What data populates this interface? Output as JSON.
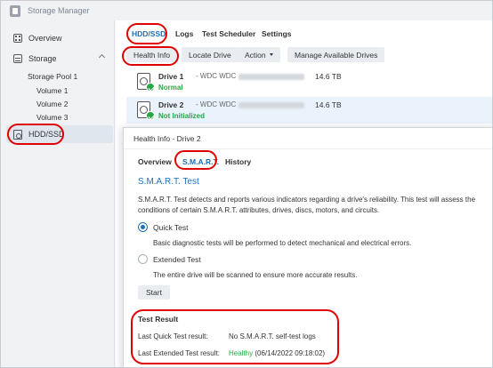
{
  "window": {
    "title": "Storage Manager"
  },
  "sidebar": {
    "overview": "Overview",
    "storage": "Storage",
    "storage_pool": "Storage Pool 1",
    "volumes": [
      "Volume 1",
      "Volume 2",
      "Volume 3"
    ],
    "hdd_ssd": "HDD/SSD"
  },
  "tabs": [
    "HDD/SSD",
    "Logs",
    "Test Scheduler",
    "Settings"
  ],
  "toolbar": {
    "health_info": "Health Info",
    "locate_drive": "Locate Drive",
    "action": "Action",
    "manage_drives": "Manage Available Drives"
  },
  "drives": [
    {
      "name": "Drive 1",
      "model": "- WDC WDC",
      "size": "14.6 TB",
      "status": "Normal"
    },
    {
      "name": "Drive 2",
      "model": "- WDC WDC",
      "size": "14.6 TB",
      "status": "Not Initialized"
    }
  ],
  "dialog": {
    "title": "Health Info - Drive 2",
    "tabs": [
      "Overview",
      "S.M.A.R.T.",
      "History"
    ],
    "section_title": "S.M.A.R.T. Test",
    "description_line1": "S.M.A.R.T. Test detects and reports various indicators regarding a drive's reliability. This test will assess the",
    "description_line2": "conditions of certain S.M.A.R.T. attributes, drives, discs, motors, and circuits.",
    "quick_test": "Quick Test",
    "quick_test_desc": "Basic diagnostic tests will be performed to detect mechanical and electrical errors.",
    "extended_test": "Extended Test",
    "extended_test_desc": "The entire drive will be scanned to ensure more accurate results.",
    "start": "Start",
    "result_title": "Test Result",
    "last_quick_label": "Last Quick Test result:",
    "last_quick_value": "No S.M.A.R.T. self-test logs",
    "last_extended_label": "Last Extended Test result:",
    "last_extended_status": "Healthy",
    "last_extended_date": "(06/14/2022 09:18:02)"
  },
  "colors": {
    "accent": "#1b6fb9",
    "healthy": "#28a745",
    "highlight": "#e00000"
  }
}
